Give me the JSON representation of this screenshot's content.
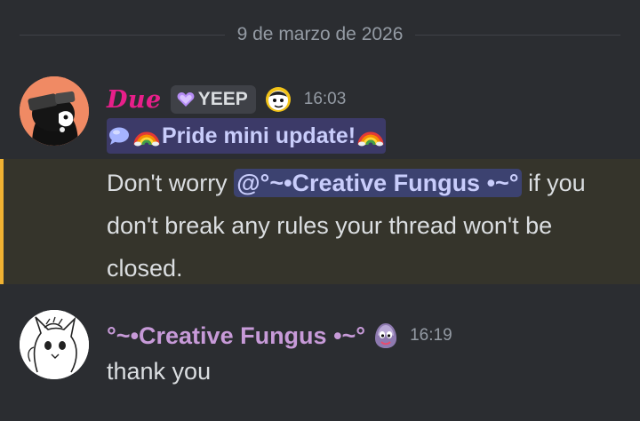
{
  "divider": {
    "date": "9 de marzo de 2026"
  },
  "messages": [
    {
      "author": "Due",
      "clan_tag": "YEEP",
      "time": "16:03",
      "pride_text": "Pride mini update!",
      "text_before": "Don't worry ",
      "mention": "@°~•Creative Fungus •~°",
      "text_after": " if you don't break any rules your thread won't be closed.",
      "highlight_color": "#f0b232"
    },
    {
      "author": "°~•Creative Fungus •~°",
      "time": "16:19",
      "text": "thank you"
    }
  ],
  "icons": {
    "clan_tag_icon": "purple-heart-icon",
    "role_icon": "blob-face-icon",
    "pride_icons": [
      "speech-bubble-icon",
      "rainbow-icon"
    ],
    "fungus_icon": "purple-creature-icon"
  },
  "colors": {
    "background": "#2b2d31",
    "due_name": "#e81f8a",
    "fungus_name": "#c79ad8",
    "mention_bg": "#3c4270",
    "mention_fg": "#c9cdfb"
  }
}
